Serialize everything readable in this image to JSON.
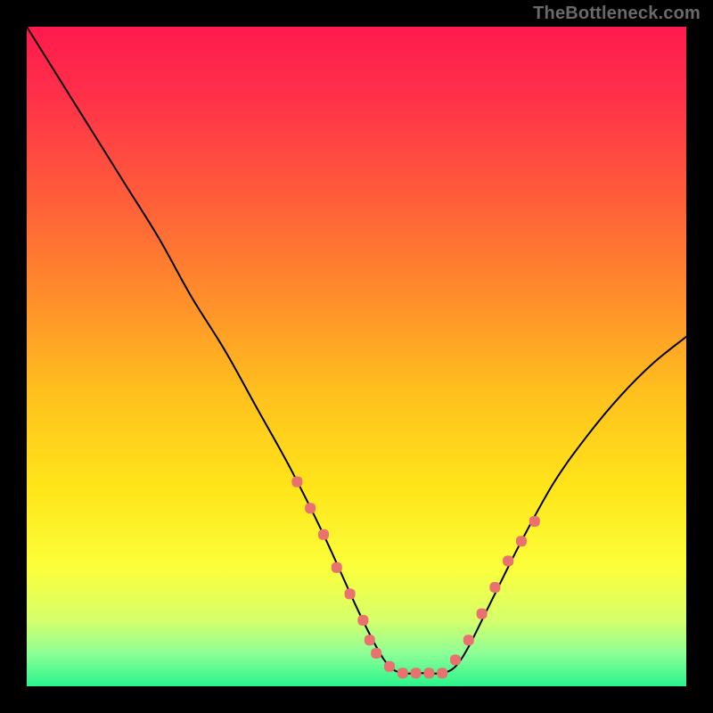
{
  "watermark": "TheBottleneck.com",
  "chart_data": {
    "type": "line",
    "title": "",
    "xlabel": "",
    "ylabel": "",
    "xlim": [
      0,
      100
    ],
    "ylim": [
      0,
      100
    ],
    "legend": false,
    "grid": false,
    "background_gradient": {
      "stops": [
        {
          "offset": 0.0,
          "color": "#ff1a4d"
        },
        {
          "offset": 0.1,
          "color": "#ff2f49"
        },
        {
          "offset": 0.25,
          "color": "#ff5a3b"
        },
        {
          "offset": 0.4,
          "color": "#ff8a2c"
        },
        {
          "offset": 0.55,
          "color": "#ffbf1e"
        },
        {
          "offset": 0.7,
          "color": "#ffe51a"
        },
        {
          "offset": 0.82,
          "color": "#fbff3a"
        },
        {
          "offset": 0.9,
          "color": "#d6ff6b"
        },
        {
          "offset": 0.95,
          "color": "#8dff97"
        },
        {
          "offset": 1.0,
          "color": "#29f58b"
        }
      ]
    },
    "series": [
      {
        "name": "bottleneck-curve",
        "color": "#000000",
        "x": [
          0,
          5,
          10,
          15,
          20,
          25,
          30,
          35,
          40,
          45,
          50,
          53,
          55,
          57,
          60,
          63,
          65,
          67,
          70,
          75,
          80,
          85,
          90,
          95,
          100
        ],
        "y": [
          100,
          92,
          84,
          76,
          68,
          59,
          51,
          42,
          33,
          23,
          12,
          6,
          3,
          2,
          2,
          2,
          3,
          6,
          12,
          22,
          31,
          38,
          44,
          49,
          53
        ]
      }
    ],
    "markers": {
      "name": "highlight-markers",
      "color": "#e9716f",
      "size": 12,
      "points": [
        {
          "x": 41,
          "y": 31
        },
        {
          "x": 43,
          "y": 27
        },
        {
          "x": 45,
          "y": 23
        },
        {
          "x": 47,
          "y": 18
        },
        {
          "x": 49,
          "y": 14
        },
        {
          "x": 51,
          "y": 10
        },
        {
          "x": 52,
          "y": 7
        },
        {
          "x": 53,
          "y": 5
        },
        {
          "x": 55,
          "y": 3
        },
        {
          "x": 57,
          "y": 2
        },
        {
          "x": 59,
          "y": 2
        },
        {
          "x": 61,
          "y": 2
        },
        {
          "x": 63,
          "y": 2
        },
        {
          "x": 65,
          "y": 4
        },
        {
          "x": 67,
          "y": 7
        },
        {
          "x": 69,
          "y": 11
        },
        {
          "x": 71,
          "y": 15
        },
        {
          "x": 73,
          "y": 19
        },
        {
          "x": 75,
          "y": 22
        },
        {
          "x": 77,
          "y": 25
        }
      ]
    }
  }
}
